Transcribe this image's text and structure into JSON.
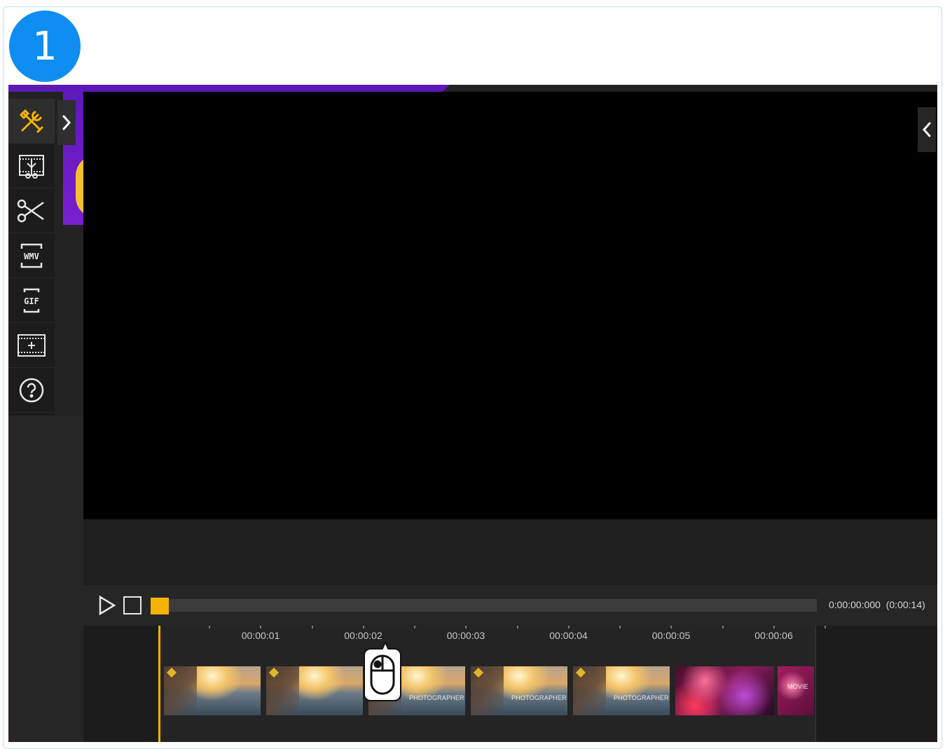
{
  "step": {
    "number": "1"
  },
  "colors": {
    "badge": "#0d8ef0",
    "accent_purple": "#5c19b8",
    "accent_yellow": "#f5b400",
    "app_background": "#222222",
    "preview_background": "#000000"
  },
  "sidebar": {
    "items": [
      {
        "icon": "tools-icon",
        "active": true
      },
      {
        "icon": "film-split-icon",
        "active": false
      },
      {
        "icon": "scissors-icon",
        "active": false
      },
      {
        "icon": "wmv-icon",
        "label": "WMV",
        "active": false
      },
      {
        "icon": "gif-icon",
        "label": "GIF",
        "active": false
      },
      {
        "icon": "add-frame-icon",
        "active": false
      },
      {
        "icon": "help-icon",
        "active": false
      }
    ]
  },
  "player": {
    "timecode": "0:00:00:000  (0:00:14)",
    "progress": 0
  },
  "timeline": {
    "ruler_labels": [
      "00:00:01",
      "00:00:02",
      "00:00:03",
      "00:00:04",
      "00:00:05",
      "00:00:06"
    ],
    "thumbnails": [
      {
        "type": "city",
        "label": ""
      },
      {
        "type": "city",
        "label": ""
      },
      {
        "type": "city",
        "label": "PHOTOGRAPHER"
      },
      {
        "type": "city",
        "label": "PHOTOGRAPHER"
      },
      {
        "type": "city",
        "label": "PHOTOGRAPHER"
      },
      {
        "type": "party",
        "label": ""
      },
      {
        "type": "party2",
        "label": "MOVIE"
      }
    ]
  },
  "callout": {
    "icon": "mouse-left-click-icon"
  }
}
